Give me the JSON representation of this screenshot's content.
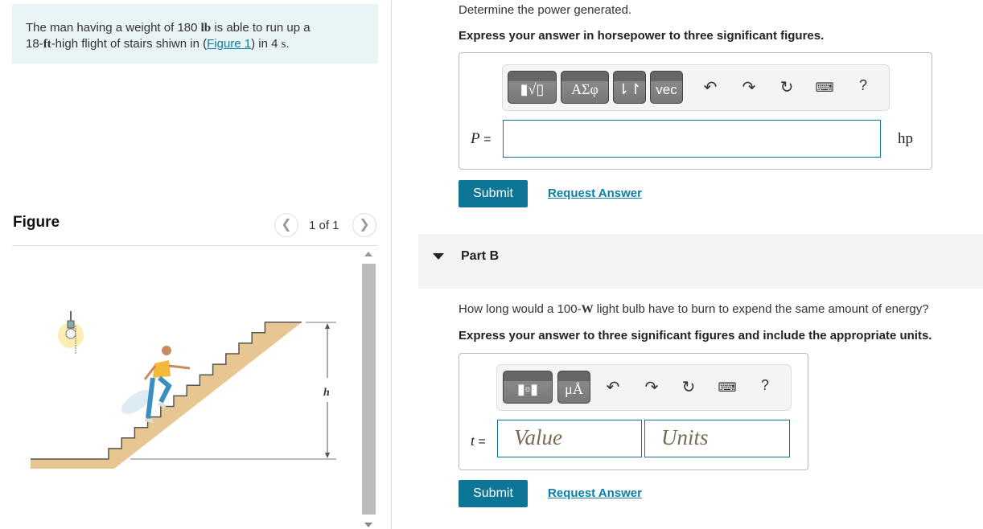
{
  "problem": {
    "text_1": "The man having a weight of 180 ",
    "weight_unit": "lb",
    "text_2": " is able to run up a",
    "line2_1": "18-",
    "height_unit": "ft",
    "line2_2": "-high flight of stairs shiwn in (",
    "figure_link": "Figure 1",
    "line2_3": ") in 4 ",
    "time_unit": "s",
    "line2_4": "."
  },
  "figure": {
    "title": "Figure",
    "count": "1 of 1",
    "prev_icon": "chevron-left",
    "next_icon": "chevron-right",
    "h_label": "h"
  },
  "part_a": {
    "prompt": "Determine the power generated.",
    "instruction": "Express your answer in horsepower to three significant figures.",
    "toolbar": {
      "templates": "▮√▯",
      "greek": "ΑΣφ",
      "arrows": "⇂↾",
      "vec": "vec",
      "undo_icon": "undo",
      "redo_icon": "redo",
      "reset_icon": "reset",
      "keyboard_icon": "keyboard",
      "help": "?"
    },
    "variable": "P",
    "equals": "=",
    "value": "",
    "unit": "hp",
    "submit": "Submit",
    "request": "Request Answer"
  },
  "part_b": {
    "label": "Part B",
    "prompt_1": "How long would a 100-",
    "watt_unit": "W",
    "prompt_2": " light bulb have to burn to expend the same amount of energy?",
    "instruction": "Express your answer to three significant figures and include the appropriate units.",
    "toolbar": {
      "units": "μÅ",
      "help": "?"
    },
    "variable": "t",
    "equals": "=",
    "value_placeholder": "Value",
    "units_placeholder": "Units",
    "submit": "Submit",
    "request": "Request Answer"
  }
}
